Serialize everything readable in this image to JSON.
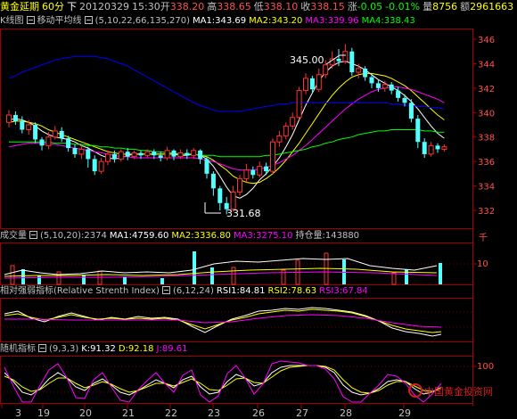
{
  "quote_bar": {
    "product": "黄金延期",
    "period": "60分",
    "direction": "下",
    "date": "20120329",
    "time": "15:30",
    "open_label": "开",
    "open": "338.20",
    "high_label": "高",
    "high": "338.65",
    "low_label": "低",
    "low": "338.10",
    "close_label": "收",
    "close": "338.15",
    "change_label": "涨",
    "change": "-0.05",
    "pct": "-0.01%",
    "volume_label": "量",
    "volume": "8756",
    "amount_label": "额",
    "amount": "2961663"
  },
  "kline_header": {
    "chart_name": "K线图",
    "indicator": "移动平均线",
    "params": "(5,10,22,66,135,270)",
    "ma1": "MA1:343.69",
    "ma2": "MA2:343.20",
    "ma3": "MA3:339.96",
    "ma4": "MA4:338.43"
  },
  "vol_header": {
    "name": "成交量",
    "params": "(5,10,20)",
    "value": ":2374",
    "ma1": "MA1:4759.60",
    "ma2": "MA2:3336.80",
    "ma3": "MA3:3275.10",
    "hold_label": "持仓量",
    "hold": ":143880",
    "unit": "千"
  },
  "rsi_header": {
    "name": "相对强弱指标(Relative Strenth Index)",
    "params": "(6,12,24)",
    "rsi1": "RSI1:84.81",
    "rsi2": "RSI2:78.63",
    "rsi3": "RSI3:67.84"
  },
  "kdj_header": {
    "name": "随机指标",
    "params": "(9,3,3)",
    "k": "K:91.32",
    "d": "D:92.18",
    "j": "J:89.61"
  },
  "price_axis": [
    "346",
    "344",
    "342",
    "340",
    "338",
    "336",
    "334",
    "332"
  ],
  "vol_axis": [
    "10"
  ],
  "kdj_axis": [
    "100"
  ],
  "annotations": {
    "high_mark": "345.00",
    "low_mark": "331.68"
  },
  "dates": [
    "3",
    "19",
    "20",
    "21",
    "22",
    "23",
    "26",
    "27",
    "28",
    "29"
  ],
  "watermark": "中国黄金投资网",
  "colors": {
    "ma1": "#ffffff",
    "ma2": "#ffff00",
    "ma3": "#ff00ff",
    "ma4": "#00ff00",
    "ma5": "#0000ff",
    "up": "#ff3232",
    "down": "#54ffff"
  },
  "chart_data": {
    "type": "candlestick",
    "ylim": [
      331,
      347
    ],
    "candles": [
      {
        "o": 339.2,
        "c": 339.8,
        "h": 340.2,
        "l": 338.8
      },
      {
        "o": 339.8,
        "c": 339.3,
        "h": 340.1,
        "l": 339.0
      },
      {
        "o": 339.3,
        "c": 338.6,
        "h": 339.7,
        "l": 338.3
      },
      {
        "o": 338.6,
        "c": 339.0,
        "h": 339.4,
        "l": 338.2
      },
      {
        "o": 339.0,
        "c": 337.8,
        "h": 339.2,
        "l": 337.5
      },
      {
        "o": 337.8,
        "c": 337.3,
        "h": 338.0,
        "l": 336.9
      },
      {
        "o": 337.3,
        "c": 338.0,
        "h": 338.4,
        "l": 337.0
      },
      {
        "o": 338.0,
        "c": 338.5,
        "h": 338.9,
        "l": 337.8
      },
      {
        "o": 338.5,
        "c": 337.9,
        "h": 338.8,
        "l": 337.6
      },
      {
        "o": 337.9,
        "c": 337.1,
        "h": 338.1,
        "l": 336.8
      },
      {
        "o": 337.1,
        "c": 336.6,
        "h": 337.4,
        "l": 336.3
      },
      {
        "o": 336.6,
        "c": 337.0,
        "h": 337.3,
        "l": 336.2
      },
      {
        "o": 337.0,
        "c": 336.2,
        "h": 337.2,
        "l": 335.5
      },
      {
        "o": 336.2,
        "c": 335.2,
        "h": 336.5,
        "l": 334.9
      },
      {
        "o": 335.2,
        "c": 336.0,
        "h": 336.3,
        "l": 335.0
      },
      {
        "o": 336.0,
        "c": 336.6,
        "h": 336.9,
        "l": 335.7
      },
      {
        "o": 336.6,
        "c": 336.2,
        "h": 336.9,
        "l": 335.9
      },
      {
        "o": 336.2,
        "c": 336.8,
        "h": 337.0,
        "l": 336.0
      },
      {
        "o": 336.8,
        "c": 336.4,
        "h": 337.1,
        "l": 336.1
      },
      {
        "o": 336.4,
        "c": 336.7,
        "h": 336.9,
        "l": 336.2
      },
      {
        "o": 336.7,
        "c": 336.5,
        "h": 336.9,
        "l": 336.2
      },
      {
        "o": 336.5,
        "c": 336.8,
        "h": 337.0,
        "l": 336.3
      },
      {
        "o": 336.8,
        "c": 336.5,
        "h": 337.0,
        "l": 336.2
      },
      {
        "o": 336.5,
        "c": 336.3,
        "h": 336.8,
        "l": 336.0
      },
      {
        "o": 336.3,
        "c": 336.9,
        "h": 337.2,
        "l": 336.1
      },
      {
        "o": 336.9,
        "c": 336.4,
        "h": 337.0,
        "l": 336.1
      },
      {
        "o": 336.4,
        "c": 336.7,
        "h": 337.0,
        "l": 336.2
      },
      {
        "o": 336.7,
        "c": 336.5,
        "h": 337.0,
        "l": 336.2
      },
      {
        "o": 336.5,
        "c": 336.9,
        "h": 337.1,
        "l": 336.2
      },
      {
        "o": 336.9,
        "c": 336.2,
        "h": 337.0,
        "l": 335.8
      },
      {
        "o": 336.2,
        "c": 335.0,
        "h": 336.4,
        "l": 334.6
      },
      {
        "o": 335.0,
        "c": 333.8,
        "h": 335.2,
        "l": 333.2
      },
      {
        "o": 333.8,
        "c": 332.6,
        "h": 334.0,
        "l": 332.0
      },
      {
        "o": 332.6,
        "c": 332.1,
        "h": 333.1,
        "l": 331.68
      },
      {
        "o": 332.1,
        "c": 333.5,
        "h": 334.0,
        "l": 331.9
      },
      {
        "o": 333.5,
        "c": 334.6,
        "h": 334.9,
        "l": 333.2
      },
      {
        "o": 334.6,
        "c": 335.3,
        "h": 335.8,
        "l": 334.3
      },
      {
        "o": 335.3,
        "c": 334.9,
        "h": 335.6,
        "l": 334.6
      },
      {
        "o": 334.9,
        "c": 335.6,
        "h": 336.0,
        "l": 334.7
      },
      {
        "o": 335.6,
        "c": 335.2,
        "h": 335.9,
        "l": 334.9
      },
      {
        "o": 335.2,
        "c": 337.6,
        "h": 337.9,
        "l": 335.0
      },
      {
        "o": 337.6,
        "c": 338.1,
        "h": 338.5,
        "l": 337.2
      },
      {
        "o": 338.1,
        "c": 338.9,
        "h": 339.2,
        "l": 337.8
      },
      {
        "o": 338.9,
        "c": 339.6,
        "h": 340.0,
        "l": 338.6
      },
      {
        "o": 339.6,
        "c": 341.8,
        "h": 342.1,
        "l": 339.4
      },
      {
        "o": 341.8,
        "c": 342.8,
        "h": 343.2,
        "l": 341.5
      },
      {
        "o": 342.8,
        "c": 341.9,
        "h": 343.0,
        "l": 341.6
      },
      {
        "o": 341.9,
        "c": 343.1,
        "h": 343.6,
        "l": 341.7
      },
      {
        "o": 343.1,
        "c": 343.9,
        "h": 344.3,
        "l": 342.8
      },
      {
        "o": 343.9,
        "c": 344.4,
        "h": 345.0,
        "l": 343.6
      },
      {
        "o": 344.4,
        "c": 344.2,
        "h": 345.2,
        "l": 343.8
      },
      {
        "o": 344.2,
        "c": 345.0,
        "h": 345.6,
        "l": 344.0
      },
      {
        "o": 345.0,
        "c": 343.3,
        "h": 345.3,
        "l": 343.0
      },
      {
        "o": 343.3,
        "c": 343.6,
        "h": 344.0,
        "l": 342.8
      },
      {
        "o": 343.6,
        "c": 342.9,
        "h": 343.8,
        "l": 342.6
      },
      {
        "o": 342.9,
        "c": 342.4,
        "h": 343.2,
        "l": 342.0
      },
      {
        "o": 342.4,
        "c": 342.0,
        "h": 342.7,
        "l": 341.7
      },
      {
        "o": 342.0,
        "c": 342.3,
        "h": 342.6,
        "l": 341.7
      },
      {
        "o": 342.3,
        "c": 341.8,
        "h": 342.5,
        "l": 341.5
      },
      {
        "o": 341.8,
        "c": 341.2,
        "h": 342.1,
        "l": 340.9
      },
      {
        "o": 341.2,
        "c": 340.8,
        "h": 341.5,
        "l": 340.5
      },
      {
        "o": 340.8,
        "c": 339.5,
        "h": 341.1,
        "l": 339.2
      },
      {
        "o": 339.5,
        "c": 337.6,
        "h": 339.8,
        "l": 337.1
      },
      {
        "o": 337.6,
        "c": 336.6,
        "h": 337.9,
        "l": 336.3
      },
      {
        "o": 336.6,
        "c": 337.3,
        "h": 337.6,
        "l": 336.4
      },
      {
        "o": 337.3,
        "c": 337.0,
        "h": 337.5,
        "l": 336.7
      },
      {
        "o": 337.0,
        "c": 337.2,
        "h": 337.4,
        "l": 336.8
      }
    ],
    "ma_lines": [
      {
        "name": "MA1",
        "values": [
          339.4,
          339.5,
          339.4,
          339.2,
          338.9,
          338.5,
          338.2,
          338.0,
          337.9,
          337.8,
          337.6,
          337.3,
          337.1,
          336.8,
          336.5,
          336.3,
          336.2,
          336.3,
          336.5,
          336.6,
          336.6,
          336.6,
          336.6,
          336.6,
          336.6,
          336.6,
          336.5,
          336.5,
          336.6,
          336.5,
          336.2,
          335.6,
          334.8,
          333.9,
          333.2,
          333.0,
          333.3,
          333.8,
          334.5,
          335.0,
          335.6,
          336.3,
          337.2,
          338.2,
          339.4,
          340.6,
          341.6,
          342.6,
          343.3,
          343.8,
          344.1,
          344.2,
          344.0,
          343.8,
          343.5,
          343.1,
          342.7,
          342.4,
          342.1,
          341.8,
          341.4,
          340.9,
          340.3,
          339.6,
          338.9,
          338.3,
          337.9
        ]
      },
      {
        "name": "MA2",
        "values": [
          339.2,
          339.3,
          339.3,
          339.2,
          339.1,
          338.9,
          338.6,
          338.4,
          338.2,
          338.0,
          337.8,
          337.6,
          337.4,
          337.2,
          337.0,
          336.8,
          336.7,
          336.6,
          336.6,
          336.6,
          336.6,
          336.6,
          336.6,
          336.6,
          336.6,
          336.6,
          336.6,
          336.6,
          336.6,
          336.5,
          336.4,
          336.1,
          335.7,
          335.3,
          334.8,
          334.5,
          334.3,
          334.2,
          334.3,
          334.6,
          335.0,
          335.5,
          336.1,
          336.8,
          337.5,
          338.3,
          339.1,
          339.9,
          340.7,
          341.4,
          342.0,
          342.5,
          342.9,
          343.1,
          343.2,
          343.2,
          343.1,
          343.0,
          342.8,
          342.5,
          342.2,
          341.8,
          341.3,
          340.8,
          340.3,
          339.8,
          339.4
        ]
      },
      {
        "name": "MA3",
        "values": [
          337.2,
          337.3,
          337.4,
          337.5,
          337.5,
          337.5,
          337.4,
          337.4,
          337.3,
          337.2,
          337.1,
          337.0,
          336.9,
          336.8,
          336.7,
          336.6,
          336.5,
          336.4,
          336.4,
          336.3,
          336.3,
          336.3,
          336.3,
          336.3,
          336.3,
          336.3,
          336.3,
          336.3,
          336.3,
          336.2,
          336.1,
          336.0,
          335.8,
          335.6,
          335.4,
          335.3,
          335.3,
          335.3,
          335.4,
          335.5,
          335.7,
          335.9,
          336.2,
          336.5,
          336.9,
          337.3,
          337.8,
          338.3,
          338.8,
          339.3,
          339.8,
          340.3,
          340.7,
          341.1,
          341.4,
          341.7,
          341.9,
          342.0,
          342.1,
          342.1,
          342.0,
          341.9,
          341.7,
          341.5,
          341.3,
          341.1,
          340.8
        ]
      },
      {
        "name": "MA4",
        "values": [
          337.6,
          337.6,
          337.6,
          337.6,
          337.6,
          337.6,
          337.6,
          337.5,
          337.5,
          337.5,
          337.4,
          337.4,
          337.3,
          337.3,
          337.2,
          337.2,
          337.1,
          337.1,
          337.0,
          337.0,
          336.9,
          336.9,
          336.8,
          336.8,
          336.7,
          336.7,
          336.6,
          336.6,
          336.6,
          336.5,
          336.5,
          336.5,
          336.4,
          336.4,
          336.4,
          336.4,
          336.4,
          336.4,
          336.4,
          336.5,
          336.5,
          336.6,
          336.7,
          336.8,
          336.9,
          337.0,
          337.2,
          337.3,
          337.5,
          337.6,
          337.8,
          337.9,
          338.0,
          338.2,
          338.3,
          338.4,
          338.5,
          338.5,
          338.6,
          338.6,
          338.6,
          338.6,
          338.6,
          338.5,
          338.5,
          338.4,
          338.4
        ]
      },
      {
        "name": "MA5",
        "values": [
          342.8,
          343.0,
          343.3,
          343.5,
          343.7,
          343.9,
          344.1,
          344.3,
          344.4,
          344.5,
          344.6,
          344.6,
          344.6,
          344.6,
          344.5,
          344.4,
          344.2,
          344.0,
          343.8,
          343.5,
          343.2,
          342.9,
          342.6,
          342.3,
          342.0,
          341.7,
          341.4,
          341.1,
          340.8,
          340.6,
          340.4,
          340.2,
          340.1,
          340.1,
          340.1,
          340.1,
          340.2,
          340.3,
          340.4,
          340.5,
          340.6,
          340.7,
          340.7,
          340.8,
          340.8,
          340.8,
          340.8,
          340.8,
          340.8,
          340.8,
          340.8,
          340.8,
          340.8,
          340.8,
          340.8,
          340.8,
          340.8,
          340.8,
          340.7,
          340.7,
          340.6,
          340.6,
          340.5,
          340.5,
          340.4,
          340.4,
          340.3
        ]
      }
    ]
  }
}
